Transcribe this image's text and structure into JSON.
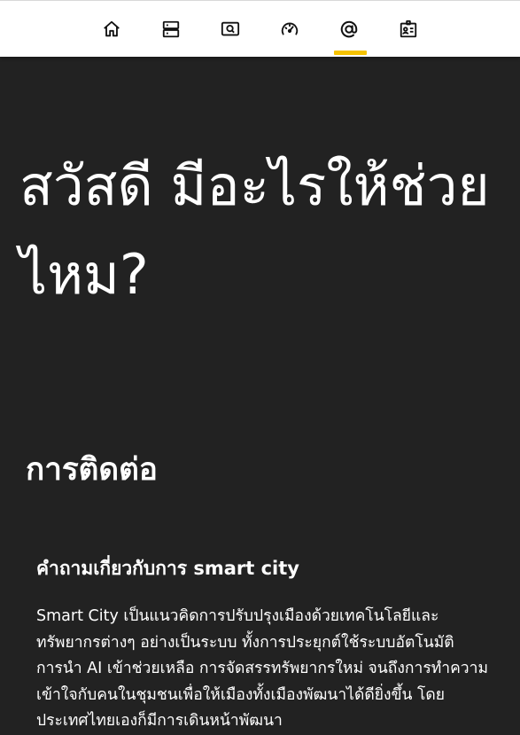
{
  "nav": {
    "items": [
      {
        "icon": "home-icon"
      },
      {
        "icon": "server-list-icon"
      },
      {
        "icon": "search-screen-icon"
      },
      {
        "icon": "gauge-speed-icon"
      },
      {
        "icon": "at-sign-icon",
        "active": true
      },
      {
        "icon": "id-card-icon"
      }
    ],
    "active_color": "#f5c200"
  },
  "hero": {
    "title": "สวัสดี มีอะไรให้ช่วยไหม?"
  },
  "contact": {
    "title": "การติดต่อ"
  },
  "faq": {
    "question": "คำถามเกี่ยวกับการ smart city",
    "answer": "Smart City เป็นแนวคิดการปรับปรุงเมืองด้วยเทคโนโลยีและทรัพยากรต่างๆ อย่างเป็นระบบ ทั้งการประยุกต์ใช้ระบบอัตโนมัติ การนำ AI เข้าช่วยเหลือ การจัดสรรทรัพยากรใหม่ จนถึงการทำความเข้าใจกับคนในชุมชนเพื่อให้เมืองทั้งเมืองพัฒนาได้ดียิ่งขึ้น โดยประเทศไทยเองก็มีการเดินหน้าพัฒนา"
  },
  "colors": {
    "background": "#222222",
    "topbar": "#ffffff",
    "accent": "#f5c200",
    "text": "#ffffff"
  }
}
